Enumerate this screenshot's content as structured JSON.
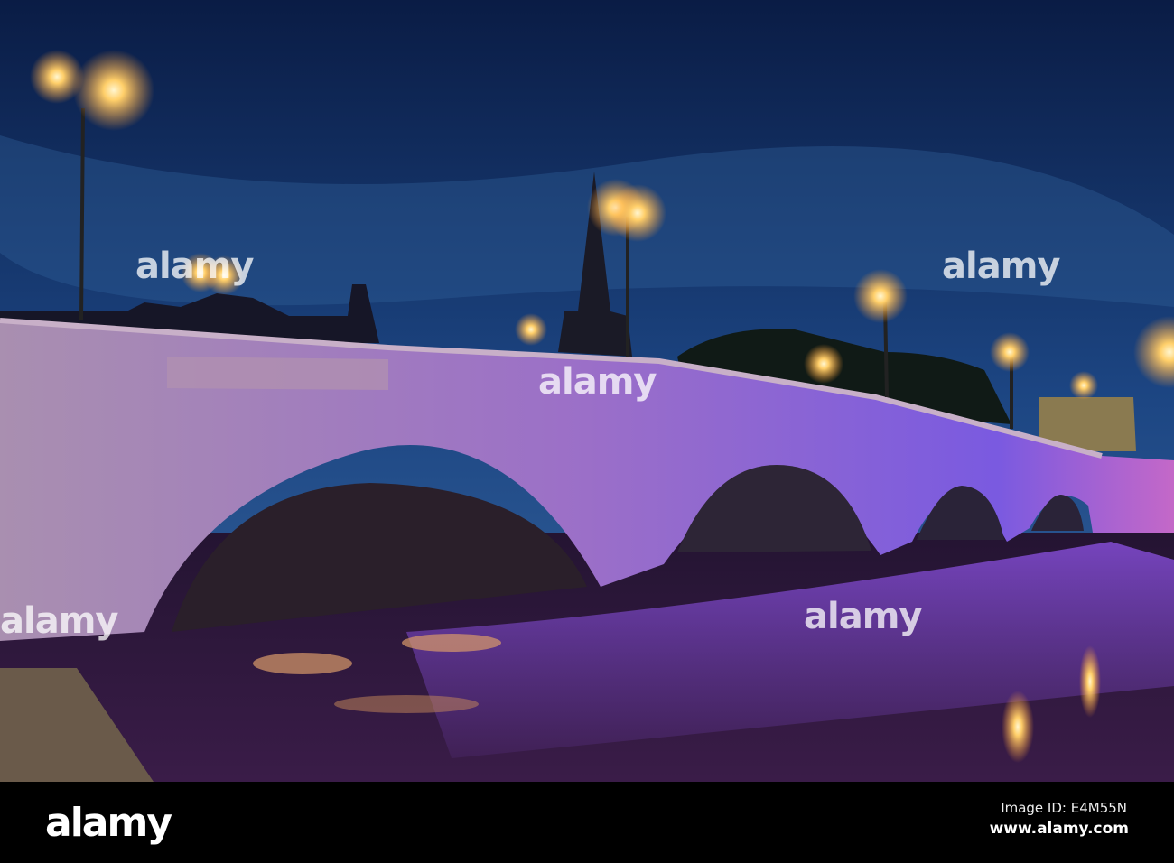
{
  "watermark": "alamy",
  "footer": {
    "logo": "alamy",
    "image_id": "Image ID: E4M55N",
    "website": "www.alamy.com"
  },
  "colors": {
    "sky_top": "#0b1f4a",
    "sky_bottom": "#3a6fa8",
    "bridge": "#9a72b8",
    "lamp": "#ffcf6a"
  }
}
